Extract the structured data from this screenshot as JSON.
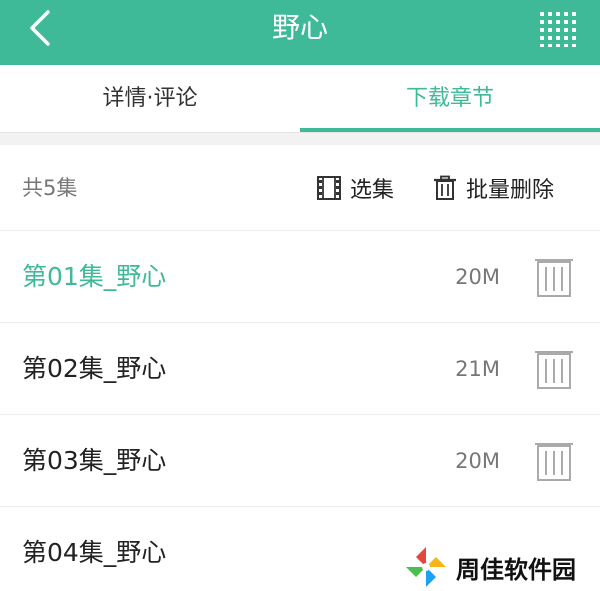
{
  "header": {
    "title": "野心",
    "back_icon": "chevron-left-icon",
    "menu_icon": "grid-menu-icon",
    "bg_color": "#3fba98"
  },
  "tabs": [
    {
      "label": "详情·评论",
      "active": false
    },
    {
      "label": "下载章节",
      "active": true
    }
  ],
  "toolbar": {
    "count_label": "共5集",
    "select_label": "选集",
    "select_icon": "film-icon",
    "batch_delete_label": "批量删除",
    "batch_delete_icon": "trash-icon"
  },
  "episodes": [
    {
      "name": "第01集_野心",
      "size": "20M",
      "active": true
    },
    {
      "name": "第02集_野心",
      "size": "21M",
      "active": false
    },
    {
      "name": "第03集_野心",
      "size": "20M",
      "active": false
    },
    {
      "name": "第04集_野心",
      "size": "",
      "active": false
    }
  ],
  "watermark": {
    "text": "周佳软件园"
  },
  "colors": {
    "accent": "#3fba98",
    "text": "#222222",
    "muted": "#777777"
  }
}
